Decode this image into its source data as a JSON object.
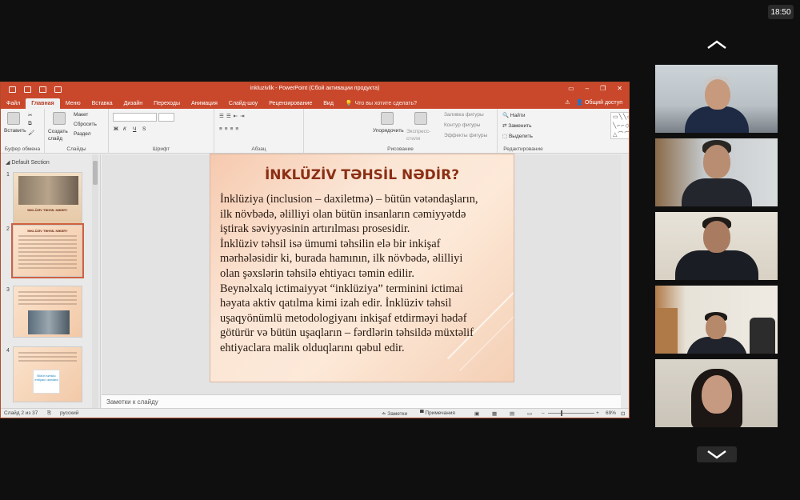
{
  "clock": "18:50",
  "window": {
    "title": "inkluzivlik - PowerPoint (Сбой активации продукта)",
    "tabs": [
      "Файл",
      "Главная",
      "Меню",
      "Вставка",
      "Дизайн",
      "Переходы",
      "Анимация",
      "Слайд-шоу",
      "Рецензирование",
      "Вид"
    ],
    "tell_me": "Что вы хотите сделать?",
    "share": "Общий доступ"
  },
  "ribbon": {
    "clipboard": {
      "paste": "Вставить",
      "label": "Буфер обмена"
    },
    "slides": {
      "new": "Создать слайд",
      "layout": "Макет",
      "reset": "Сбросить",
      "section": "Раздел",
      "label": "Слайды"
    },
    "font": {
      "label": "Шрифт"
    },
    "paragraph": {
      "label": "Абзац"
    },
    "drawing": {
      "arrange": "Упорядочить",
      "quick_styles": "Экспресс-стили",
      "fill": "Заливка фигуры",
      "outline": "Контур фигуры",
      "effects": "Эффекты фигуры",
      "label": "Рисование"
    },
    "editing": {
      "find": "Найти",
      "replace": "Заменить",
      "select": "Выделить",
      "label": "Редактирование"
    }
  },
  "thumbnails": {
    "section": "Default Section",
    "items": [
      {
        "num": "1",
        "caption": "İNKLÜZİV TƏHSİL NƏDİR?"
      },
      {
        "num": "2",
        "caption": "İNKLÜZİV TƏHSİL NƏDİR?"
      },
      {
        "num": "3",
        "caption": ""
      },
      {
        "num": "4",
        "caption": "Bütün təhsilə ehtiyacı olanlara"
      }
    ]
  },
  "slide": {
    "title": "İNKLÜZİV TƏHSİL NƏDİR?",
    "body": "İnklüziya (inclusion – daxiletmə) – bütün vətəndaşların,\nilk növbədə, əlilliyi olan bütün insanların cəmiyyətdə\niştirak səviyyəsinin artırılması prosesidir.\nİnklüziv təhsil isə ümumi təhsilin elə bir inkişaf\nmərhələsidir ki, burada hamının, ilk növbədə, əlilliyi\nolan şəxslərin təhsilə ehtiyacı təmin edilir.\nBeynəlxalq ictimaiyyət “inklüziya” terminini ictimai\nhəyata aktiv qatılma kimi izah edir. İnklüziv təhsil\nuşaqyönümlü metodologiyanı inkişaf etdirməyi hədəf\ngötürür və bütün uşaqların – fərdlərin təhsildə müxtəlif\nehtiyaclara malik olduqlarını qəbul edir."
  },
  "notes_placeholder": "Заметки к слайду",
  "status": {
    "slide": "Слайд 2 из 37",
    "language": "русский",
    "notes": "Заметки",
    "comments": "Примечания",
    "zoom": "69%"
  }
}
